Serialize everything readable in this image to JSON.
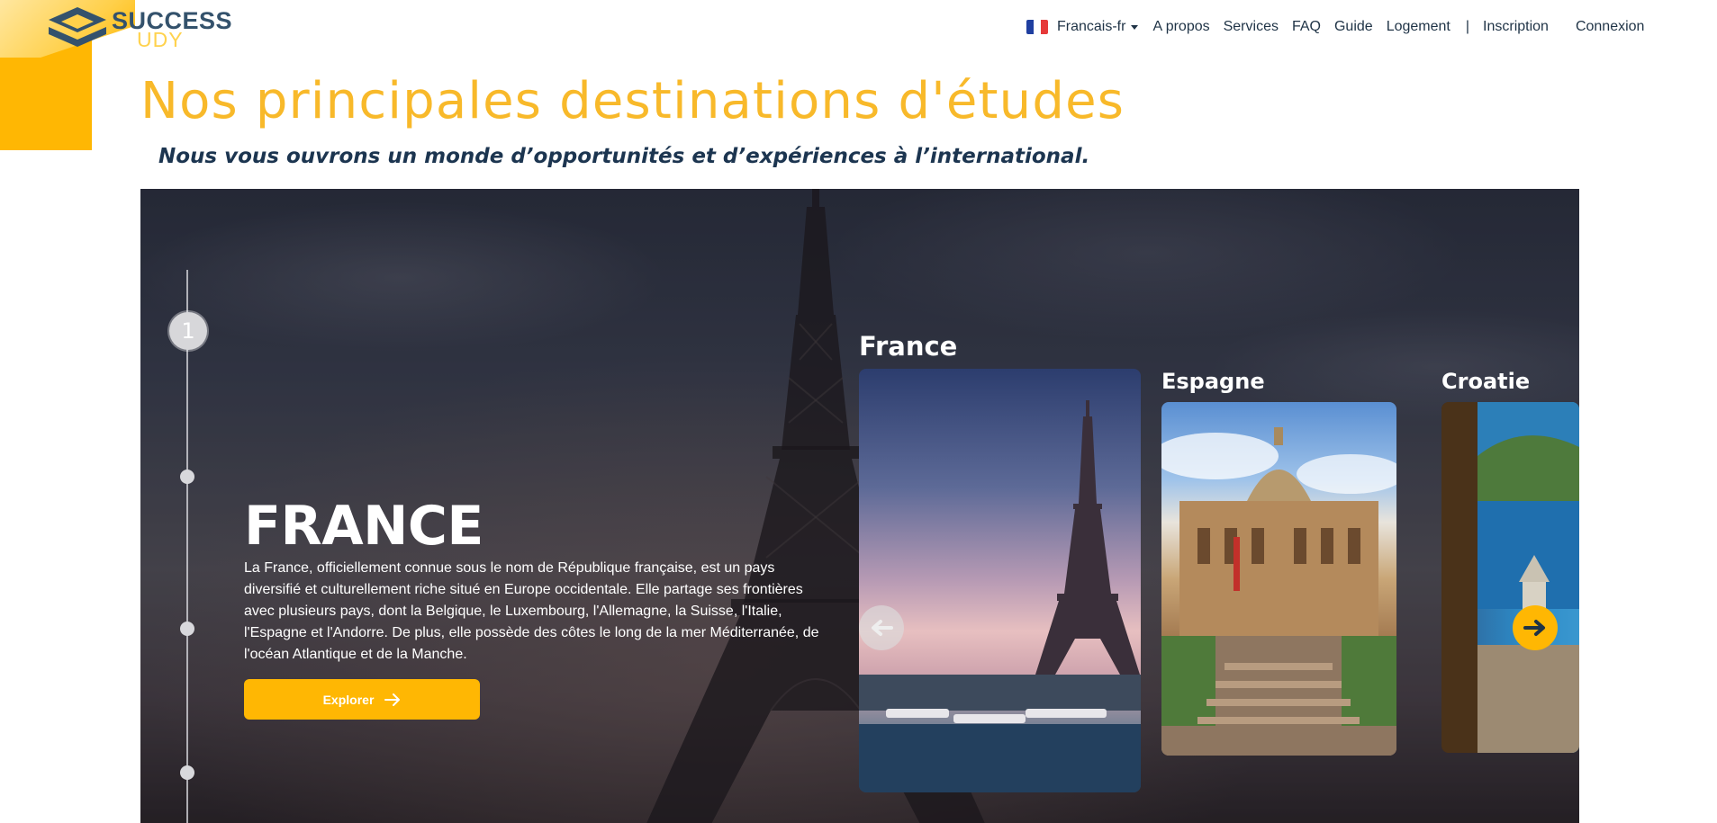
{
  "brand": {
    "word1": "SUCCESS",
    "word2": "UDY",
    "accent": "#ffb703",
    "dark": "#34526c"
  },
  "nav": {
    "language": {
      "label": "Francais-fr",
      "flag": "france-flag-icon"
    },
    "items": [
      "A propos",
      "Services",
      "FAQ",
      "Guide",
      "Logement"
    ],
    "separator": "|",
    "inscription": "Inscription",
    "connexion": "Connexion"
  },
  "page": {
    "title": "Nos principales destinations d'études",
    "subtitle": "Nous vous ouvrons un monde d’opportunités et d’expériences à l’international."
  },
  "hero": {
    "step_number": "1",
    "country": "FRANCE",
    "description": "La France, officiellement connue sous le nom de République française, est un pays diversifié et culturellement riche situé en Europe occidentale. Elle partage ses frontières avec plusieurs pays, dont la Belgique, le Luxembourg, l'Allemagne, la Suisse, l'Italie, l'Espagne et l'Andorre. De plus, elle possède des côtes le long de la mer Méditerranée, de l'océan Atlantique et de la Manche.",
    "button_label": "Explorer",
    "button_icon": "arrow-right-icon"
  },
  "cards": [
    {
      "name": "France"
    },
    {
      "name": "Espagne"
    },
    {
      "name": "Croatie"
    }
  ],
  "carousel": {
    "prev_icon": "arrow-left-icon",
    "next_icon": "arrow-right-icon"
  }
}
